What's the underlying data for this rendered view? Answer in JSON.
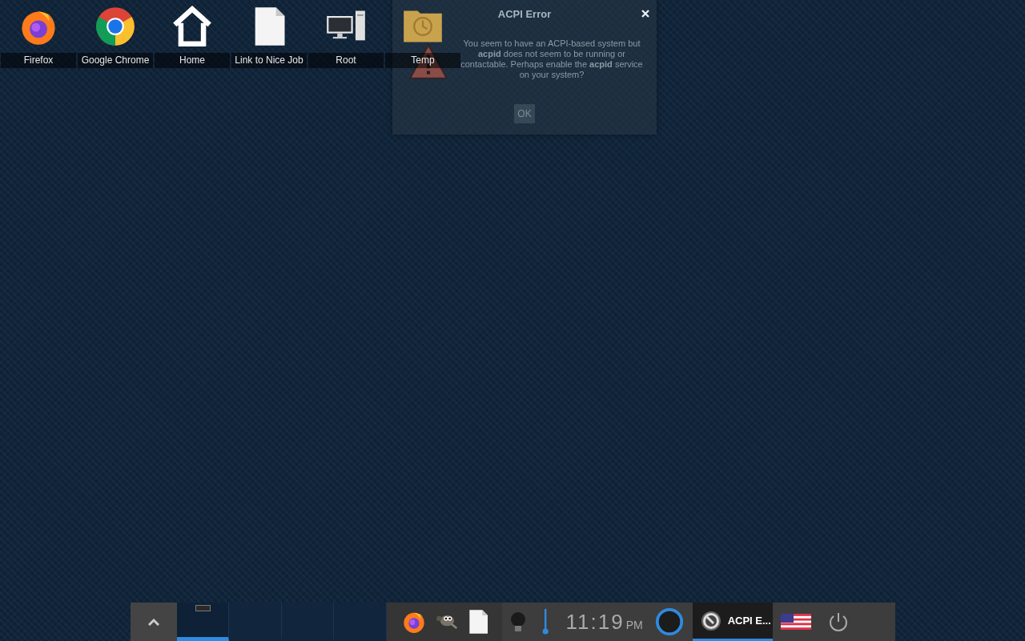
{
  "desktop_icons": [
    {
      "kind": "firefox",
      "label": "Firefox"
    },
    {
      "kind": "chrome",
      "label": "Google Chrome"
    },
    {
      "kind": "home",
      "label": "Home"
    },
    {
      "kind": "document",
      "label": "Link to Nice Job"
    },
    {
      "kind": "computer",
      "label": "Root"
    },
    {
      "kind": "folder",
      "label": "Temp"
    }
  ],
  "dialog": {
    "title": "ACPI Error",
    "message": "You seem to have an ACPI-based system but **acpid** does not seem to be running or contactable. Perhaps enable the **acpid** service on your system?",
    "button": "OK"
  },
  "taskbar": {
    "desktops": [
      {
        "selected": true
      },
      {
        "selected": false
      },
      {
        "selected": false
      },
      {
        "selected": false
      }
    ],
    "launchers": [
      {
        "kind": "firefox"
      },
      {
        "kind": "gimp"
      },
      {
        "kind": "document"
      }
    ],
    "clock": {
      "time": "11:19",
      "period": "PM"
    },
    "tasks": [
      {
        "label": "ACPI E...",
        "selected": true
      }
    ]
  }
}
